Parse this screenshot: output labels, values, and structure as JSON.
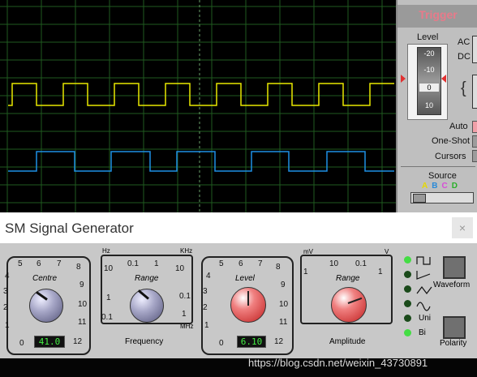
{
  "trigger": {
    "title": "Trigger",
    "level_label": "Level",
    "scale": [
      "-20",
      "-10",
      "0",
      "10"
    ],
    "ac_label": "AC",
    "dc_label": "DC",
    "auto_label": "Auto",
    "one_shot_label": "One-Shot",
    "cursors_label": "Cursors",
    "source_label": "Source",
    "source_channels": [
      "A",
      "B",
      "C",
      "D"
    ],
    "source_colors": [
      "#e6d800",
      "#2a8ad8",
      "#d84bd8",
      "#2ab02a"
    ]
  },
  "scope": {
    "trace_a_color": "#e8e800",
    "trace_b_color": "#1e8fe6"
  },
  "generator": {
    "title": "SM Signal Generator",
    "close_label": "×",
    "centre_label": "Centre",
    "centre_ticks": [
      "5",
      "6",
      "7",
      "8",
      "9",
      "10",
      "11",
      "12",
      "0",
      "1",
      "2",
      "3",
      "4"
    ],
    "centre_value": "41.0",
    "freq_range_label": "Range",
    "freq_units": {
      "hz": "Hz",
      "khz": "KHz",
      "mhz": "MHz"
    },
    "freq_ticks": [
      "10",
      "0.1",
      "1",
      "10",
      "1",
      "0.1",
      "0.1",
      "1"
    ],
    "frequency_label": "Frequency",
    "level_label": "Level",
    "level_ticks": [
      "5",
      "6",
      "7",
      "8",
      "9",
      "10",
      "11",
      "12",
      "0",
      "1",
      "2",
      "3",
      "4"
    ],
    "level_value": "6.10",
    "amp_units": {
      "mv": "mV",
      "v": "V"
    },
    "amp_ticks": [
      "10",
      "0.1",
      "1",
      "1"
    ],
    "amp_range_label": "Range",
    "amplitude_label": "Amplitude",
    "waveform_label": "Waveform",
    "uni_label": "Uni",
    "bi_label": "Bi",
    "polarity_label": "Polarity"
  },
  "watermark": "https://blog.csdn.net/weixin_43730891"
}
